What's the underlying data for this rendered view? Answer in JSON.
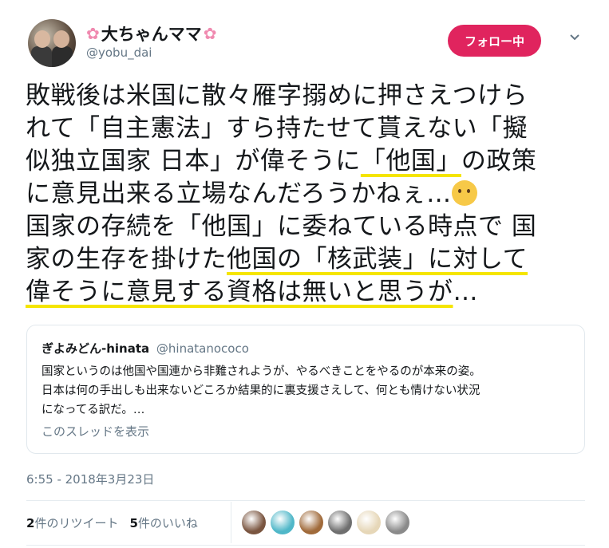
{
  "header": {
    "display_name": "大ちゃんママ",
    "handle": "@yobu_dai",
    "follow_label": "フォロー中",
    "name_decoration_icon": "cherry-blossom-icon",
    "menu_icon": "chevron-down-icon"
  },
  "tweet": {
    "lines": [
      {
        "pre": "敗戦後は米国に散々雁字搦めに押さえつけら",
        "u": "",
        "post": ""
      },
      {
        "pre": "れて「自主憲法」すら持たせて貰えない「擬",
        "u": "",
        "post": ""
      },
      {
        "pre": "似独立国家 日本」が偉そうに",
        "u": "「他国」",
        "post": "の政策"
      },
      {
        "pre": "に意見出来る立場なんだろうかねぇ…",
        "u": "",
        "post": ""
      },
      {
        "pre": "国家の存続を「他国」に委ねている時点で 国",
        "u": "",
        "post": ""
      },
      {
        "pre": "家の生存を掛けた",
        "u": "他国の「核武装」に対して",
        "post": ""
      },
      {
        "pre": "",
        "u": "偉そうに意見する資格は無いと思うが",
        "post": "…"
      }
    ],
    "emoji": "thinking-face-icon",
    "accent_underline": "#f5e500"
  },
  "quote": {
    "name": "ぎよみどん-hinata",
    "handle": "@hinatanococo",
    "lines": [
      "国家というのは他国や国連から非難されようが、やるべきことをやるのが本来の姿。",
      "日本は何の手出しも出来ないどころか結果的に裏支援さえして、何とも情けない状況",
      "になってる訳だ。…"
    ],
    "show_thread": "このスレッドを表示"
  },
  "timestamp": "6:55 - 2018年3月23日",
  "stats": {
    "retweets_count": "2",
    "retweets_label": "件のリツイート",
    "likes_count": "5",
    "likes_label": "件のいいね"
  },
  "likers": [
    {
      "color": "#7a5540"
    },
    {
      "color": "#4fb7c8"
    },
    {
      "color": "#a06a3a"
    },
    {
      "color": "#6f6f6f"
    },
    {
      "color": "#e6d7b8"
    },
    {
      "color": "#8a8a8a"
    }
  ],
  "colors": {
    "follow_button": "#e0245e",
    "secondary_text": "#657786"
  }
}
